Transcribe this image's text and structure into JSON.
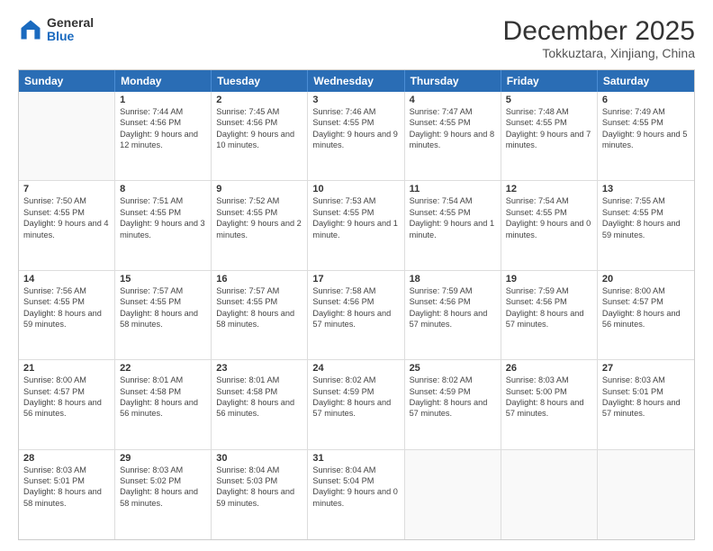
{
  "logo": {
    "general": "General",
    "blue": "Blue"
  },
  "header": {
    "month_year": "December 2025",
    "location": "Tokkuztara, Xinjiang, China"
  },
  "weekdays": [
    "Sunday",
    "Monday",
    "Tuesday",
    "Wednesday",
    "Thursday",
    "Friday",
    "Saturday"
  ],
  "weeks": [
    [
      {
        "day": "",
        "sunrise": "",
        "sunset": "",
        "daylight": ""
      },
      {
        "day": "1",
        "sunrise": "Sunrise: 7:44 AM",
        "sunset": "Sunset: 4:56 PM",
        "daylight": "Daylight: 9 hours and 12 minutes."
      },
      {
        "day": "2",
        "sunrise": "Sunrise: 7:45 AM",
        "sunset": "Sunset: 4:56 PM",
        "daylight": "Daylight: 9 hours and 10 minutes."
      },
      {
        "day": "3",
        "sunrise": "Sunrise: 7:46 AM",
        "sunset": "Sunset: 4:55 PM",
        "daylight": "Daylight: 9 hours and 9 minutes."
      },
      {
        "day": "4",
        "sunrise": "Sunrise: 7:47 AM",
        "sunset": "Sunset: 4:55 PM",
        "daylight": "Daylight: 9 hours and 8 minutes."
      },
      {
        "day": "5",
        "sunrise": "Sunrise: 7:48 AM",
        "sunset": "Sunset: 4:55 PM",
        "daylight": "Daylight: 9 hours and 7 minutes."
      },
      {
        "day": "6",
        "sunrise": "Sunrise: 7:49 AM",
        "sunset": "Sunset: 4:55 PM",
        "daylight": "Daylight: 9 hours and 5 minutes."
      }
    ],
    [
      {
        "day": "7",
        "sunrise": "Sunrise: 7:50 AM",
        "sunset": "Sunset: 4:55 PM",
        "daylight": "Daylight: 9 hours and 4 minutes."
      },
      {
        "day": "8",
        "sunrise": "Sunrise: 7:51 AM",
        "sunset": "Sunset: 4:55 PM",
        "daylight": "Daylight: 9 hours and 3 minutes."
      },
      {
        "day": "9",
        "sunrise": "Sunrise: 7:52 AM",
        "sunset": "Sunset: 4:55 PM",
        "daylight": "Daylight: 9 hours and 2 minutes."
      },
      {
        "day": "10",
        "sunrise": "Sunrise: 7:53 AM",
        "sunset": "Sunset: 4:55 PM",
        "daylight": "Daylight: 9 hours and 1 minute."
      },
      {
        "day": "11",
        "sunrise": "Sunrise: 7:54 AM",
        "sunset": "Sunset: 4:55 PM",
        "daylight": "Daylight: 9 hours and 1 minute."
      },
      {
        "day": "12",
        "sunrise": "Sunrise: 7:54 AM",
        "sunset": "Sunset: 4:55 PM",
        "daylight": "Daylight: 9 hours and 0 minutes."
      },
      {
        "day": "13",
        "sunrise": "Sunrise: 7:55 AM",
        "sunset": "Sunset: 4:55 PM",
        "daylight": "Daylight: 8 hours and 59 minutes."
      }
    ],
    [
      {
        "day": "14",
        "sunrise": "Sunrise: 7:56 AM",
        "sunset": "Sunset: 4:55 PM",
        "daylight": "Daylight: 8 hours and 59 minutes."
      },
      {
        "day": "15",
        "sunrise": "Sunrise: 7:57 AM",
        "sunset": "Sunset: 4:55 PM",
        "daylight": "Daylight: 8 hours and 58 minutes."
      },
      {
        "day": "16",
        "sunrise": "Sunrise: 7:57 AM",
        "sunset": "Sunset: 4:55 PM",
        "daylight": "Daylight: 8 hours and 58 minutes."
      },
      {
        "day": "17",
        "sunrise": "Sunrise: 7:58 AM",
        "sunset": "Sunset: 4:56 PM",
        "daylight": "Daylight: 8 hours and 57 minutes."
      },
      {
        "day": "18",
        "sunrise": "Sunrise: 7:59 AM",
        "sunset": "Sunset: 4:56 PM",
        "daylight": "Daylight: 8 hours and 57 minutes."
      },
      {
        "day": "19",
        "sunrise": "Sunrise: 7:59 AM",
        "sunset": "Sunset: 4:56 PM",
        "daylight": "Daylight: 8 hours and 57 minutes."
      },
      {
        "day": "20",
        "sunrise": "Sunrise: 8:00 AM",
        "sunset": "Sunset: 4:57 PM",
        "daylight": "Daylight: 8 hours and 56 minutes."
      }
    ],
    [
      {
        "day": "21",
        "sunrise": "Sunrise: 8:00 AM",
        "sunset": "Sunset: 4:57 PM",
        "daylight": "Daylight: 8 hours and 56 minutes."
      },
      {
        "day": "22",
        "sunrise": "Sunrise: 8:01 AM",
        "sunset": "Sunset: 4:58 PM",
        "daylight": "Daylight: 8 hours and 56 minutes."
      },
      {
        "day": "23",
        "sunrise": "Sunrise: 8:01 AM",
        "sunset": "Sunset: 4:58 PM",
        "daylight": "Daylight: 8 hours and 56 minutes."
      },
      {
        "day": "24",
        "sunrise": "Sunrise: 8:02 AM",
        "sunset": "Sunset: 4:59 PM",
        "daylight": "Daylight: 8 hours and 57 minutes."
      },
      {
        "day": "25",
        "sunrise": "Sunrise: 8:02 AM",
        "sunset": "Sunset: 4:59 PM",
        "daylight": "Daylight: 8 hours and 57 minutes."
      },
      {
        "day": "26",
        "sunrise": "Sunrise: 8:03 AM",
        "sunset": "Sunset: 5:00 PM",
        "daylight": "Daylight: 8 hours and 57 minutes."
      },
      {
        "day": "27",
        "sunrise": "Sunrise: 8:03 AM",
        "sunset": "Sunset: 5:01 PM",
        "daylight": "Daylight: 8 hours and 57 minutes."
      }
    ],
    [
      {
        "day": "28",
        "sunrise": "Sunrise: 8:03 AM",
        "sunset": "Sunset: 5:01 PM",
        "daylight": "Daylight: 8 hours and 58 minutes."
      },
      {
        "day": "29",
        "sunrise": "Sunrise: 8:03 AM",
        "sunset": "Sunset: 5:02 PM",
        "daylight": "Daylight: 8 hours and 58 minutes."
      },
      {
        "day": "30",
        "sunrise": "Sunrise: 8:04 AM",
        "sunset": "Sunset: 5:03 PM",
        "daylight": "Daylight: 8 hours and 59 minutes."
      },
      {
        "day": "31",
        "sunrise": "Sunrise: 8:04 AM",
        "sunset": "Sunset: 5:04 PM",
        "daylight": "Daylight: 9 hours and 0 minutes."
      },
      {
        "day": "",
        "sunrise": "",
        "sunset": "",
        "daylight": ""
      },
      {
        "day": "",
        "sunrise": "",
        "sunset": "",
        "daylight": ""
      },
      {
        "day": "",
        "sunrise": "",
        "sunset": "",
        "daylight": ""
      }
    ]
  ]
}
